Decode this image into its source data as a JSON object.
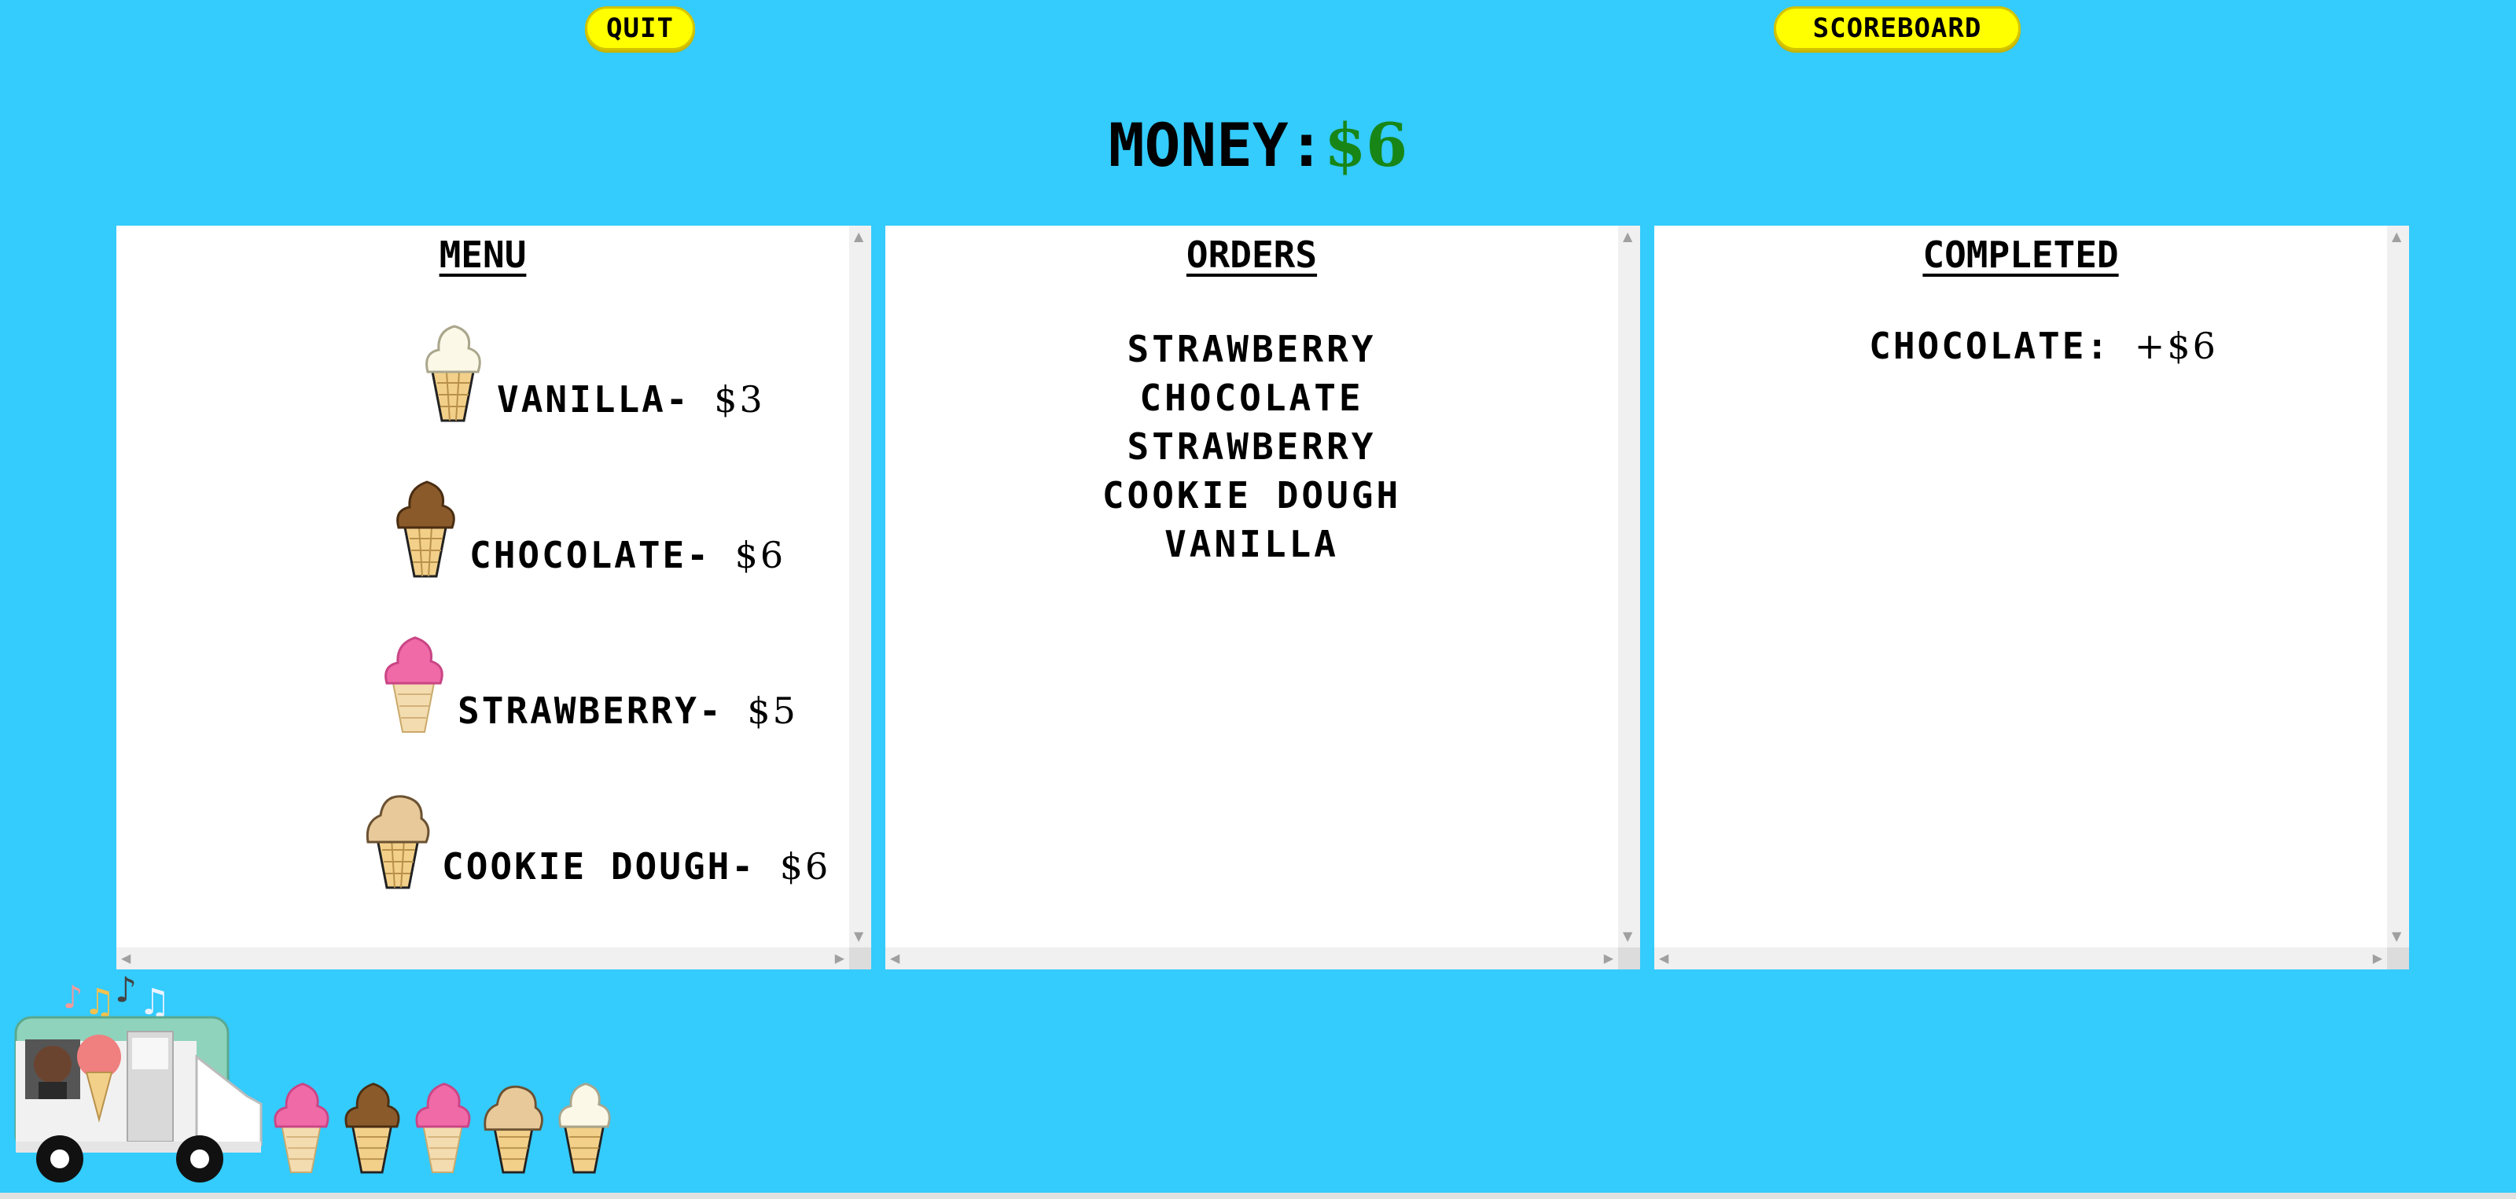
{
  "buttons": {
    "quit": "QUIT",
    "scoreboard": "SCOREBOARD"
  },
  "money": {
    "label": "MONEY:",
    "amount": "$6"
  },
  "menu": {
    "title": "MENU",
    "items": [
      {
        "name": "VANILLA",
        "sep": "- ",
        "price": "$3",
        "icon": "vanilla-cone-icon",
        "color": "#f7f3e0"
      },
      {
        "name": "CHOCOLATE",
        "sep": "- ",
        "price": "$6",
        "icon": "chocolate-cone-icon",
        "color": "#8b5a2b"
      },
      {
        "name": "STRAWBERRY",
        "sep": "- ",
        "price": "$5",
        "icon": "strawberry-cone-icon",
        "color": "#f06aa8"
      },
      {
        "name": "COOKIE DOUGH",
        "sep": "- ",
        "price": "$6",
        "icon": "cookie-dough-cone-icon",
        "color": "#e8c99a"
      }
    ]
  },
  "orders": {
    "title": "ORDERS",
    "items": [
      "STRAWBERRY",
      "CHOCOLATE",
      "STRAWBERRY",
      "COOKIE DOUGH",
      "VANILLA"
    ]
  },
  "completed": {
    "title": "COMPLETED",
    "items": [
      {
        "name": "CHOCOLATE",
        "sep": ": ",
        "price": "+$6"
      }
    ]
  },
  "truck": {
    "icon": "ice-cream-truck-icon",
    "notes_icon": "music-notes-icon",
    "cones": [
      "strawberry-cone-icon",
      "chocolate-cone-icon",
      "strawberry-cone-icon",
      "cookie-dough-cone-icon",
      "vanilla-cone-icon"
    ]
  },
  "colors": {
    "background": "#34cbfd",
    "button": "#ffff00",
    "money": "#178617"
  }
}
